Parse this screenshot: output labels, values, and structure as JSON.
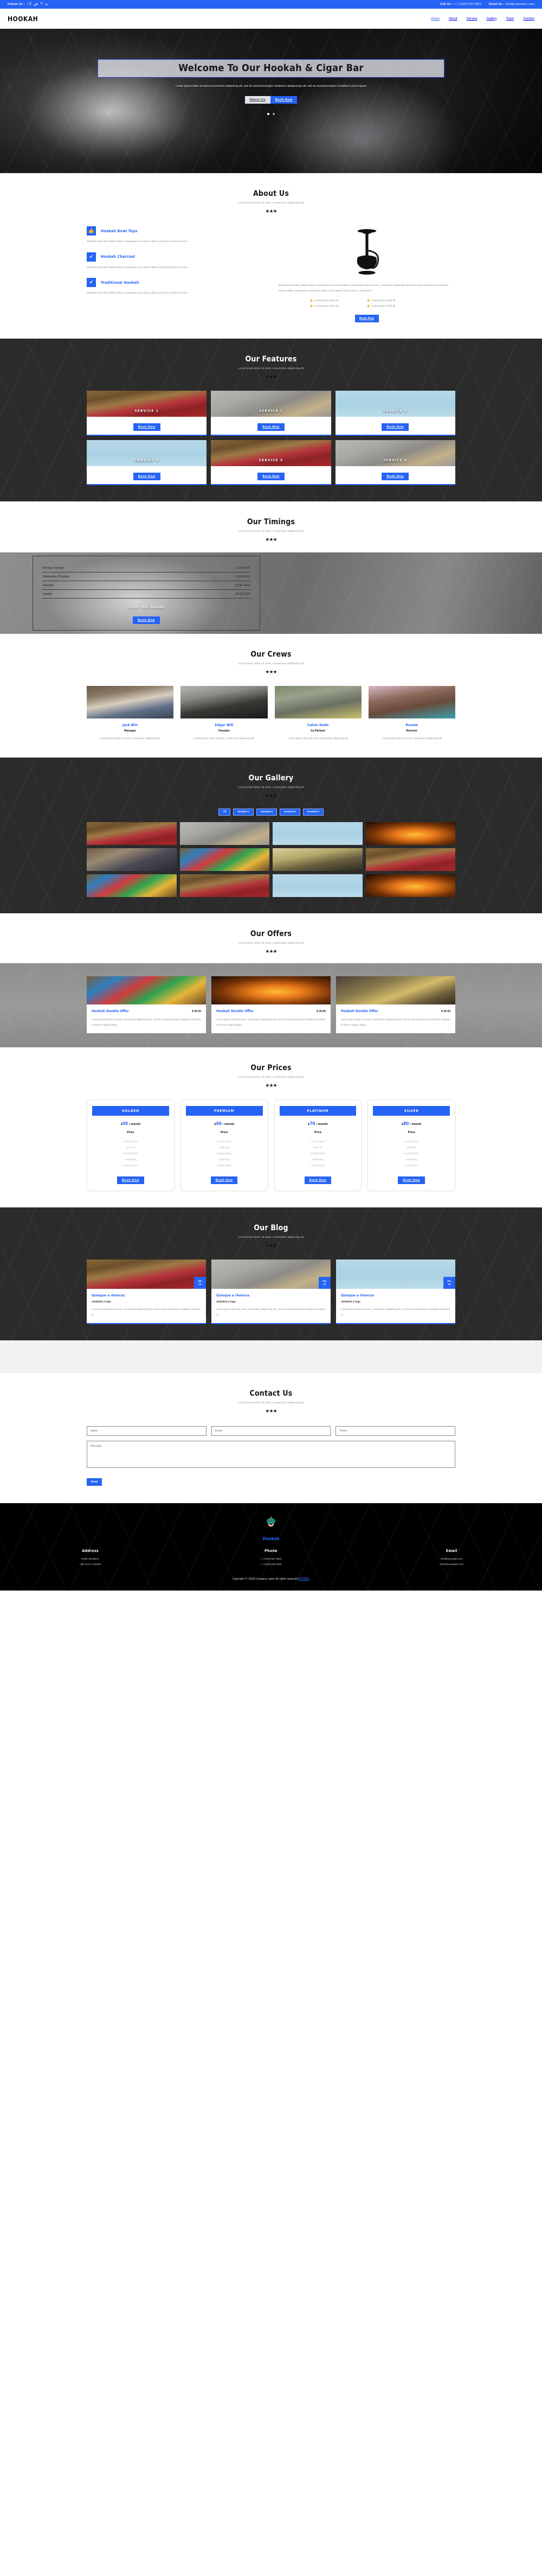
{
  "topbar": {
    "follow_label": "Follow Us :",
    "socials": [
      "facebook-icon",
      "twitter-icon",
      "rss-icon",
      "vk-icon"
    ],
    "call_label": "Call Us :",
    "call_value": "+ 1 (000) 555 9901",
    "email_label": "Email Us :",
    "email_value": "info@example1.com"
  },
  "nav": {
    "brand": "HOOKAH",
    "links": [
      "Home",
      "About",
      "Service",
      "Gallery",
      "Team",
      "Contact"
    ]
  },
  "hero": {
    "title": "Welcome To Our Hookah & Cigar Bar",
    "subtitle": "Lorem ipsum dolor sit amet,consectetur adipiscing elit, sed do eiusmod tempor incididunt utadipiscing elit, sed do eiusmod tempor incididunt Lorem ipsum",
    "btn_about": "About Us",
    "btn_book": "Book Now"
  },
  "about": {
    "heading": "About Us",
    "subheading": "Lorem ipsum dolor sit amet, consectetur adipiscing elit",
    "stars": "★★★",
    "features": [
      {
        "icon": "thumbs-up-icon",
        "glyph": "👍",
        "title": "Hookah Bowl Tops",
        "text": "delectus reiciendis maiores alias consequatur aut.maiores alias Lorem ipsum dolor sit amet"
      },
      {
        "icon": "check-icon",
        "glyph": "✔",
        "title": "Hookah Charcoal",
        "text": "delectus reiciendis maiores alias consequatur aut.maiores alias Lorem ipsum dolor sit amet"
      },
      {
        "icon": "check-icon",
        "glyph": "✔",
        "title": "Traditional Hookah",
        "text": "delectus reiciendis maiores alias consequatur aut.maiores alias Lorem ipsum dolor sit amet"
      }
    ],
    "body": "delectus reiciendis maiores alias consequatur aut.maiores alias Lorem ipsum dolor sit amet, consectetur adipiscing elit sed do eiusmod delectus reiciendis maiores alias consequatur aut.maiores alias Lorem ipsum dolor sit amet, consectetur",
    "list": [
      "Lorem ipsum dolor sit",
      "Lorem ipsum dolor sit",
      "Lorem ipsum dolor sit",
      "Lorem ipsum dolor sit"
    ],
    "book_label": "Book Now"
  },
  "features": {
    "heading": "Our Features",
    "subheading": "Lorem ipsum dolor sit amet, consectetur adipiscing elit",
    "stars": "★★★",
    "cards": [
      {
        "label": "SERVICE 1",
        "btn": "Book Now",
        "img": "ph-room"
      },
      {
        "label": "SERVICE 2",
        "btn": "Book Now",
        "img": "ph-pipes"
      },
      {
        "label": "SERVICE 3",
        "btn": "Book Now",
        "img": "ph-blue"
      },
      {
        "label": "SERVICE 4",
        "btn": "Book Now",
        "img": "ph-blue"
      },
      {
        "label": "SERVICE 5",
        "btn": "Book Now",
        "img": "ph-room"
      },
      {
        "label": "SERVICE 6",
        "btn": "Book Now",
        "img": "ph-pipes"
      }
    ]
  },
  "timings": {
    "heading": "Our Timings",
    "subheading": "Lorem ipsum dolor sit amet, consectetur adipiscing elit",
    "stars": "★★★",
    "rows": [
      {
        "day": "Monday-Tuesday",
        "time": "11:30-10:30"
      },
      {
        "day": "Wednesday-Thursday",
        "time": "11:00-10:30"
      },
      {
        "day": "Saturday",
        "time": "10:30-14:30"
      },
      {
        "day": "Sunday",
        "time": "10:00-11:00"
      }
    ],
    "caption": "Enjoy Your Hookah",
    "btn": "Book Now"
  },
  "crews": {
    "heading": "Our Crews",
    "subheading": "Lorem ipsum dolor sit amet, consectetur adipiscing elit",
    "stars": "★★★",
    "members": [
      {
        "name": "Jack Win",
        "role": "Manager",
        "text": "Lorem ipsum dolor sit amet, consectetur adipiscing elit",
        "img": "ph-jack"
      },
      {
        "name": "Edgar Will",
        "role": "Founder",
        "text": "Lorem ipsum dolor sit amet, consectetur adipiscing elit",
        "img": "ph-edgar"
      },
      {
        "name": "Calvin Hedo",
        "role": "Co-Partner",
        "text": "Lorem ipsum dolor sit amet, consectetur adipiscing elit",
        "img": "ph-calvin"
      },
      {
        "name": "Ronnie",
        "role": "Director",
        "text": "Lorem ipsum dolor sit amet, consectetur adipiscing elit",
        "img": "ph-ronnie"
      }
    ]
  },
  "gallery": {
    "heading": "Our Gallery",
    "subheading": "Lorem ipsum dolor sit amet, consectetur adipiscing elit",
    "stars": "★★★",
    "tabs": [
      "All",
      "Hookah-1",
      "Hookah-2",
      "Hookah-3",
      "Hookah-4"
    ],
    "images": [
      "ph-room",
      "ph-pipes",
      "ph-blue",
      "ph-fire",
      "ph-face",
      "ph-colorful",
      "ph-dark2",
      "ph-room",
      "ph-colorful",
      "ph-room",
      "ph-blue",
      "ph-fire"
    ]
  },
  "offers": {
    "heading": "Our Offers",
    "subheading": "Lorem ipsum dolor sit amet, consectetur adipiscing elit",
    "stars": "★★★",
    "items": [
      {
        "title": "Hookah Double Offer",
        "price": "$ 35:00",
        "text": "Lorem ipsum dolor sit amet, consectetur adipisicing elit, sed do eiusmod tempor incididunt ut labore et dolore magna aliqua",
        "img": "ph-colorful"
      },
      {
        "title": "Hookah Double Offer",
        "price": "$ 35:00",
        "text": "Lorem ipsum dolor sit amet, consectetur adipisicing elit, sed do eiusmod tempor incididunt ut labore et dolore magna aliqua",
        "img": "ph-fire"
      },
      {
        "title": "Hookah Double Offer",
        "price": "$ 35:00",
        "text": "Lorem ipsum dolor sit amet, consectetur adipisicing elit, sed do eiusmod tempor incididunt ut labore et dolore magna aliqua",
        "img": "ph-gold"
      }
    ]
  },
  "prices": {
    "heading": "Our Prices",
    "subheading": "Lorem ipsum dolor sit amet, consectetur adipiscing elit",
    "stars": "★★★",
    "plans": [
      {
        "name": "GOLDEN",
        "currency": "$",
        "amount": "50",
        "period": "/ month",
        "label": "Price",
        "features": [
          "Lorem ipsum",
          "Dolor sit",
          "Consectetuer",
          "Adipiscing",
          "Lorem ipsum"
        ],
        "btn": "Book Now"
      },
      {
        "name": "PREMIUM",
        "currency": "$",
        "amount": "60",
        "period": "/ month",
        "label": "Price",
        "features": [
          "Lorem ipsum",
          "Dolor sit",
          "Consectetuer",
          "Adipiscing",
          "Lorem ipsum"
        ],
        "btn": "Book Now"
      },
      {
        "name": "PLATINUM",
        "currency": "$",
        "amount": "70",
        "period": "/ month",
        "label": "Price",
        "features": [
          "Lorem ipsum",
          "Dolor sit",
          "Consectetuer",
          "Adipiscing",
          "Lorem ipsum"
        ],
        "btn": "Book Now"
      },
      {
        "name": "SILVER",
        "currency": "$",
        "amount": "80",
        "period": "/ month",
        "label": "Price",
        "features": [
          "Lorem ipsum",
          "Dolor sit",
          "Consectetuer",
          "Adipiscing",
          "Lorem ipsum"
        ],
        "btn": "Book Now"
      }
    ]
  },
  "blog": {
    "heading": "Our Blog",
    "subheading": "Lorem ipsum dolor sit amet, consectetur adipiscing elit",
    "stars": "★★★",
    "posts": [
      {
        "title": "Quisque a rhoncus",
        "meta": "12/4/2019  3 Tags",
        "month": "JUL",
        "day": "15",
        "text": "Lorem ipsum dolor sit amet, consectetur adipiscing elit, sed do eiusmod tempor incididunt ut labore et",
        "img": "ph-room"
      },
      {
        "title": "Quisque a rhoncus",
        "meta": "12/4/2019  3 Tags",
        "month": "JUL",
        "day": "15",
        "text": "Lorem ipsum dolor sit amet, consectetur adipiscing elit, sed do eiusmod tempor incididunt ut labore et",
        "img": "ph-pipes"
      },
      {
        "title": "Quisque a rhoncus",
        "meta": "12/4/2019  3 Tags",
        "month": "JUL",
        "day": "15",
        "text": "Lorem ipsum dolor sit amet, consectetur adipiscing elit, sed do eiusmod tempor incididunt ut labore et",
        "img": "ph-blue"
      }
    ]
  },
  "contact": {
    "heading": "Contact Us",
    "subheading": "Lorem ipsum dolor sit amet, consectetur adipiscing elit",
    "stars": "★★★",
    "name_placeholder": "Name",
    "email_placeholder": "Email",
    "phone_placeholder": "Phone",
    "message_placeholder": "Message",
    "send_label": "Send"
  },
  "footer": {
    "logo_icon": "person-with-turban-icon",
    "brand": "Hookah",
    "columns": [
      {
        "title": "Address",
        "lines": [
          "South Brisbane,",
          "Old 4101 Australia"
        ]
      },
      {
        "title": "Phone",
        "lines": [
          "+ 1 (234) 567 8901",
          "+ 1 (000) 555 9901"
        ]
      },
      {
        "title": "Email",
        "lines": [
          "info@example.com",
          "info2@example.com"
        ]
      }
    ],
    "copyright": "Copyright © 2018.Company name All rights reserved.",
    "copyright_link": "网页模板"
  },
  "colors": {
    "accent": "#2563f5",
    "dark": "#2b2b2b",
    "black": "#000000"
  }
}
